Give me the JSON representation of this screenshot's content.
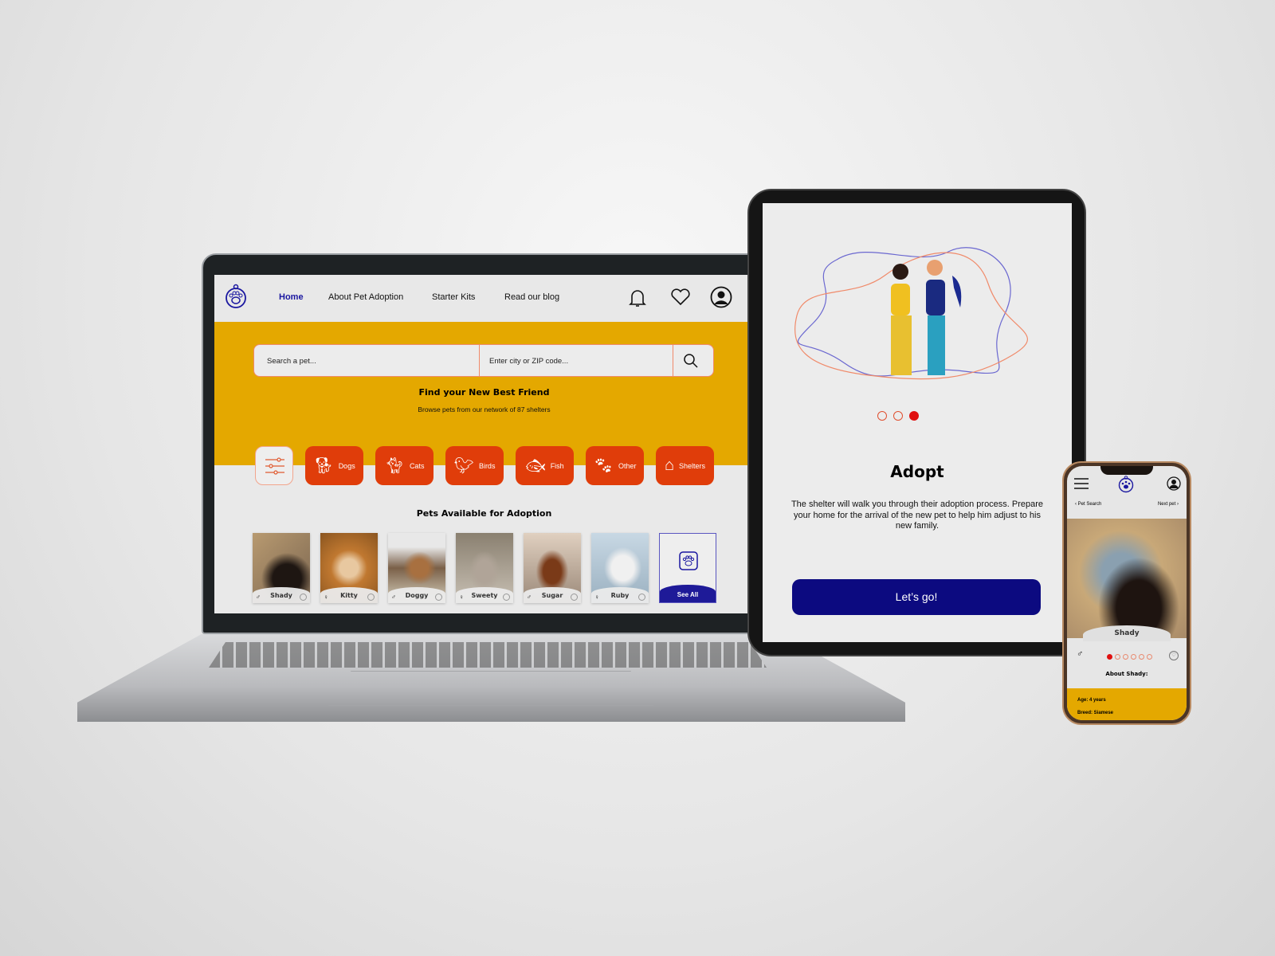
{
  "laptop": {
    "nav": {
      "items": [
        {
          "label": "Home",
          "active": true
        },
        {
          "label": "About Pet Adoption"
        },
        {
          "label": "Starter Kits"
        },
        {
          "label": "Read our blog"
        }
      ],
      "icons": [
        "bell-icon",
        "heart-icon",
        "user-icon"
      ],
      "logo": "paw-logo-icon"
    },
    "search": {
      "pet_placeholder": "Search a pet...",
      "location_placeholder": "Enter city or ZIP code...",
      "icon": "search-icon"
    },
    "hero": {
      "title": "Find your New Best Friend",
      "subtitle": "Browse pets from our network of 87 shelters"
    },
    "categories": [
      {
        "label": "Dogs",
        "icon": "dog-icon"
      },
      {
        "label": "Cats",
        "icon": "cat-icon"
      },
      {
        "label": "Birds",
        "icon": "bird-icon"
      },
      {
        "label": "Fish",
        "icon": "fishbowl-icon"
      },
      {
        "label": "Other",
        "icon": "paw-icon"
      },
      {
        "label": "Shelters",
        "icon": "doghouse-icon"
      }
    ],
    "pets_title": "Pets Available for Adoption",
    "pets": [
      {
        "name": "Shady",
        "gender": "♂"
      },
      {
        "name": "Kitty",
        "gender": "♀"
      },
      {
        "name": "Doggy",
        "gender": "♂"
      },
      {
        "name": "Sweety",
        "gender": "♀"
      },
      {
        "name": "Sugar",
        "gender": "♂"
      },
      {
        "name": "Ruby",
        "gender": "♀"
      }
    ],
    "see_all": "See All"
  },
  "tablet": {
    "title": "Adopt",
    "body": "The shelter will walk you through their adoption process. Prepare your home for the arrival of the new pet to help him adjust to his new family.",
    "button": "Let’s go!",
    "page_dots": {
      "count": 3,
      "active": 3
    }
  },
  "phone": {
    "back": "Pet Search",
    "next": "Next pet",
    "pet_name": "Shady",
    "gender": "♂",
    "photo_dots": {
      "count": 6,
      "active": 1
    },
    "about_title": "About Shady:",
    "age": "Age: 4 years",
    "breed": "Breed: Siamese"
  },
  "colors": {
    "yellow": "#e4a800",
    "orange": "#e03d0a",
    "navy": "#0c0a80",
    "red_dot": "#e01010"
  }
}
